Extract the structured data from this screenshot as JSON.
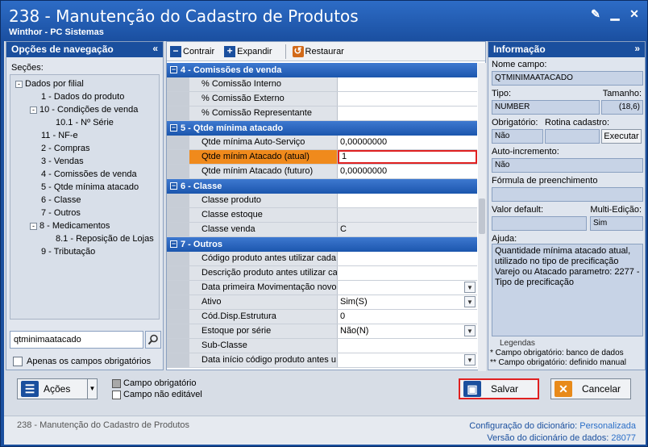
{
  "window": {
    "title": "238 - Manutenção do Cadastro de Produtos",
    "subtitle": "Winthor - PC Sistemas"
  },
  "nav": {
    "header": "Opções de navegação",
    "sections_label": "Seções:",
    "tree": [
      {
        "label": "Dados por filial",
        "level": 0,
        "toggle": "-"
      },
      {
        "label": "1 - Dados do produto",
        "level": 1,
        "toggle": ""
      },
      {
        "label": "10 - Condições de venda",
        "level": 1,
        "toggle": "-"
      },
      {
        "label": "10.1 - Nº Série",
        "level": 2,
        "toggle": ""
      },
      {
        "label": "11 - NF-e",
        "level": 1,
        "toggle": ""
      },
      {
        "label": "2 - Compras",
        "level": 1,
        "toggle": ""
      },
      {
        "label": "3 - Vendas",
        "level": 1,
        "toggle": ""
      },
      {
        "label": "4 - Comissões de venda",
        "level": 1,
        "toggle": ""
      },
      {
        "label": "5 - Qtde mínima atacado",
        "level": 1,
        "toggle": ""
      },
      {
        "label": "6 - Classe",
        "level": 1,
        "toggle": ""
      },
      {
        "label": "7 - Outros",
        "level": 1,
        "toggle": ""
      },
      {
        "label": "8 - Medicamentos",
        "level": 1,
        "toggle": "-"
      },
      {
        "label": "8.1 -  Reposição de Lojas",
        "level": 2,
        "toggle": ""
      },
      {
        "label": "9 - Tributação",
        "level": 1,
        "toggle": ""
      }
    ],
    "search_value": "qtminimaatacado",
    "only_required_label": "Apenas os campos obrigatórios"
  },
  "toolbar": {
    "collapse": "Contrair",
    "expand": "Expandir",
    "restore": "Restaurar"
  },
  "grid": [
    {
      "category": "4 - Comissões de venda",
      "rows": [
        {
          "name": "% Comissão Interno",
          "value": "",
          "kind": "normal"
        },
        {
          "name": "% Comissão Externo",
          "value": "",
          "kind": "normal"
        },
        {
          "name": "% Comissão Representante",
          "value": "",
          "kind": "normal"
        }
      ]
    },
    {
      "category": "5 - Qtde mínima atacado",
      "rows": [
        {
          "name": "Qtde mínima Auto-Serviço",
          "value": "0,00000000",
          "kind": "normal"
        },
        {
          "name": "Qtde mínim Atacado (atual)",
          "value": "1",
          "kind": "selected"
        },
        {
          "name": "Qtde mínim Atacado (futuro)",
          "value": "0,00000000",
          "kind": "normal"
        }
      ]
    },
    {
      "category": "6 - Classe",
      "rows": [
        {
          "name": "Classe produto",
          "value": "",
          "kind": "normal"
        },
        {
          "name": "Classe estoque",
          "value": "",
          "kind": "readonly"
        },
        {
          "name": "Classe venda",
          "value": "C",
          "kind": "readonly"
        }
      ]
    },
    {
      "category": "7 - Outros",
      "rows": [
        {
          "name": "Código produto antes utilizar cada",
          "value": "",
          "kind": "normal"
        },
        {
          "name": "Descrição produto antes utilizar ca",
          "value": "",
          "kind": "normal"
        },
        {
          "name": "Data primeira Movimentação novo",
          "value": "",
          "kind": "dropdown"
        },
        {
          "name": "Ativo",
          "value": "Sim(S)",
          "kind": "dropdown"
        },
        {
          "name": "Cód.Disp.Estrutura",
          "value": "0",
          "kind": "normal"
        },
        {
          "name": "Estoque por série",
          "value": "Não(N)",
          "kind": "dropdown"
        },
        {
          "name": "Sub-Classe",
          "value": "",
          "kind": "normal"
        },
        {
          "name": "Data início código produto antes u",
          "value": "",
          "kind": "dropdown"
        }
      ]
    }
  ],
  "info": {
    "header": "Informação",
    "field_name_label": "Nome campo:",
    "field_name": "QTMINIMAATACADO",
    "type_label": "Tipo:",
    "size_label": "Tamanho:",
    "type": "NUMBER",
    "size": "(18,6)",
    "required_label": "Obrigatório:",
    "routine_label": "Rotina cadastro:",
    "required": "Não",
    "execute": "Executar",
    "autoinc_label": "Auto-incremento:",
    "autoinc": "Não",
    "formula_label": "Fórmula de preenchimento",
    "default_label": "Valor default:",
    "multi_label": "Multi-Edição:",
    "multi": "Sim",
    "help_label": "Ajuda:",
    "help_text": "Quantidade mínima atacado atual, utilizado no tipo de precificação Varejo ou Atacado parametro: 2277 - Tipo de precificação",
    "legend_title": "Legendas",
    "legend_1": "* Campo obrigatório: banco de dados",
    "legend_2": "** Campo obrigatório: definido manual"
  },
  "actions": {
    "actions": "Ações",
    "legend_required": "Campo obrigatório",
    "legend_readonly": "Campo não editável",
    "save": "Salvar",
    "cancel": "Cancelar"
  },
  "status": {
    "left": "238 - Manutenção do Cadastro de Produtos",
    "dict_config_label": "Configuração do dicionário:",
    "dict_config": "Personalizada",
    "dict_version_label": "Versão do dicionário de dados:",
    "dict_version": "28077"
  },
  "colors": {
    "title_bar": "#1a4f9e",
    "selected_row": "#f08a1c",
    "edit_border": "#e02020"
  }
}
